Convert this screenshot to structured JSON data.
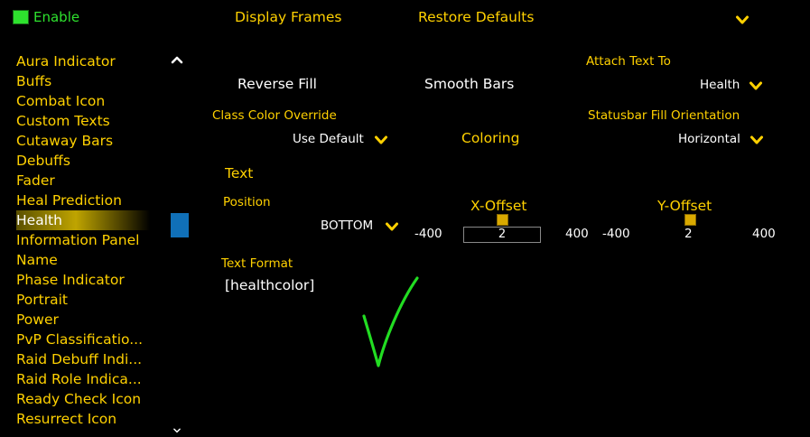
{
  "enable": {
    "label": "Enable",
    "checked": true
  },
  "nav": {
    "items": [
      "Aura Indicator",
      "Buffs",
      "Combat Icon",
      "Custom Texts",
      "Cutaway Bars",
      "Debuffs",
      "Fader",
      "Heal Prediction",
      "Health",
      "Information Panel",
      "Name",
      "Phase Indicator",
      "Portrait",
      "Power",
      "PvP Classificatio...",
      "Raid Debuff Indi...",
      "Raid Role Indica...",
      "Ready Check Icon",
      "Resurrect Icon"
    ],
    "active": "Health"
  },
  "top": {
    "display_frames": "Display Frames",
    "restore_defaults": "Restore Defaults"
  },
  "general": {
    "reverse_fill": "Reverse Fill",
    "smooth_bars": "Smooth Bars",
    "attach_text_to_label": "Attach Text To",
    "attach_text_to_value": "Health",
    "class_color_override_label": "Class Color Override",
    "class_color_override_value": "Use Default",
    "coloring": "Coloring",
    "statusbar_fill_orientation_label": "Statusbar Fill Orientation",
    "statusbar_fill_orientation_value": "Horizontal"
  },
  "text": {
    "heading": "Text",
    "position_label": "Position",
    "position_value": "BOTTOM",
    "x_offset": {
      "label": "X-Offset",
      "min": "-400",
      "max": "400",
      "value": "2"
    },
    "y_offset": {
      "label": "Y-Offset",
      "min": "-400",
      "max": "400",
      "value": "2"
    },
    "text_format_label": "Text Format",
    "text_format_value": "[healthcolor]"
  },
  "colors": {
    "gold": "#ffd100",
    "active_row": "#bfa400",
    "scrollbar": "#1070b8",
    "enable": "#2ee22e",
    "checkmark": "#22dd22"
  },
  "icons": [
    "chevron-down-icon",
    "chevron-up-icon",
    "checkmark-icon"
  ]
}
